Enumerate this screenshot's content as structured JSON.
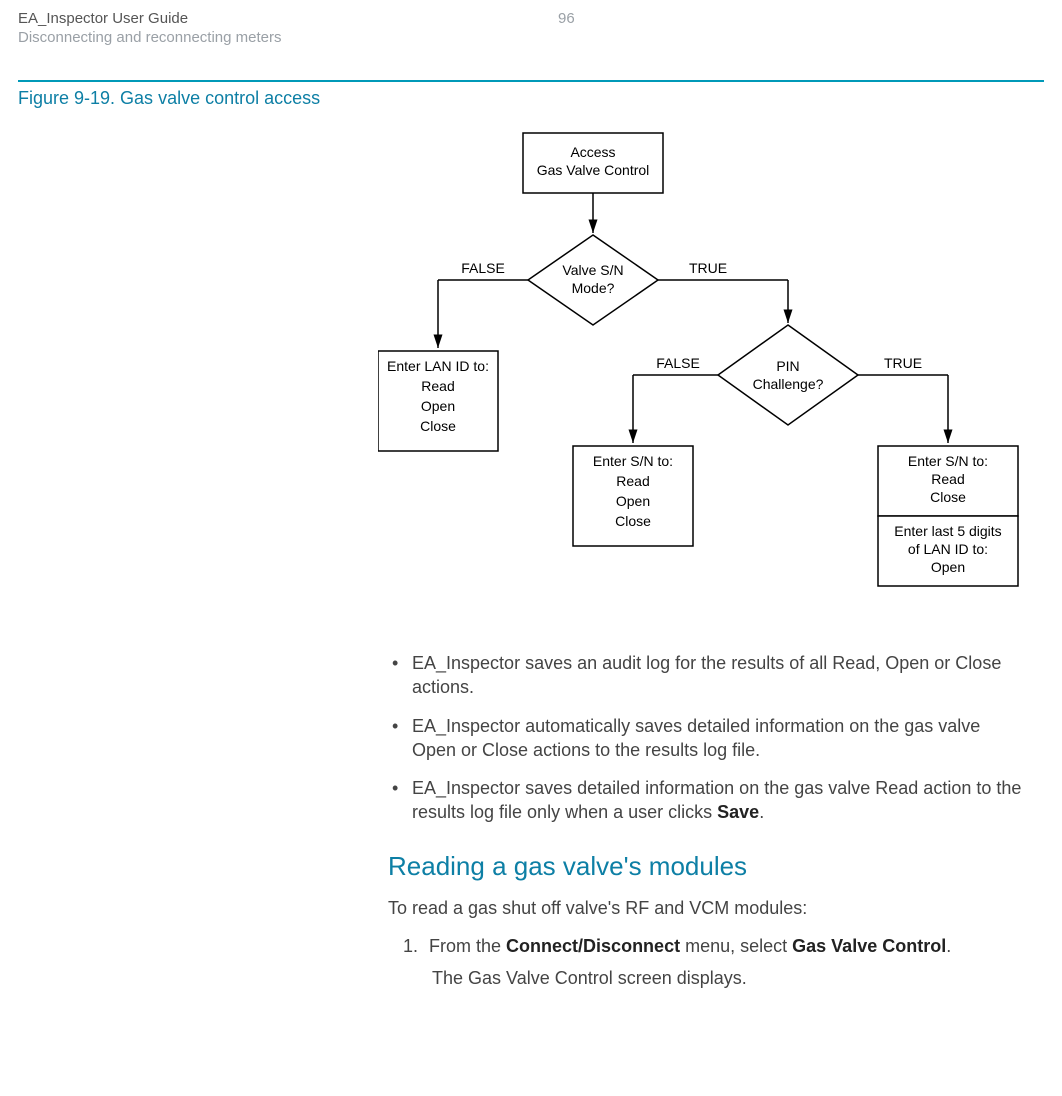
{
  "header": {
    "title": "EA_Inspector User Guide",
    "subtitle": "Disconnecting and reconnecting meters",
    "page_number": "96"
  },
  "figure": {
    "caption": "Figure 9-19. Gas valve control access",
    "nodes": {
      "access_l1": "Access",
      "access_l2": "Gas Valve Control",
      "decision1_l1": "Valve S/N",
      "decision1_l2": "Mode?",
      "decision2_l1": "PIN",
      "decision2_l2": "Challenge?",
      "lan_l1": "Enter LAN ID to:",
      "lan_l2": "Read",
      "lan_l3": "Open",
      "lan_l4": "Close",
      "sn_l1": "Enter S/N to:",
      "sn_l2": "Read",
      "sn_l3": "Open",
      "sn_l4": "Close",
      "sn_pin_top_l1": "Enter S/N to:",
      "sn_pin_top_l2": "Read",
      "sn_pin_top_l3": "Close",
      "sn_pin_bot_l1": "Enter last 5 digits",
      "sn_pin_bot_l2": "of LAN ID to:",
      "sn_pin_bot_l3": "Open"
    },
    "labels": {
      "false": "FALSE",
      "true": "TRUE"
    }
  },
  "bullets": [
    {
      "pre": "EA_Inspector saves an audit log for the results of all Read, Open or Close actions."
    },
    {
      "pre": "EA_Inspector automatically saves detailed information on the gas valve Open or Close actions to the results log file."
    },
    {
      "pre": "EA_Inspector saves detailed information on the gas valve Read action to the results log file only when a user clicks ",
      "bold": "Save",
      "post": "."
    }
  ],
  "section": {
    "heading": "Reading a gas valve's modules",
    "intro": "To read a gas shut off valve's RF and VCM modules:",
    "step1": {
      "num": "1.",
      "pre": "From the ",
      "bold1": "Connect/Disconnect",
      "mid": " menu, select ",
      "bold2": "Gas Valve Control",
      "post": ".",
      "follow": "The Gas Valve Control screen displays."
    }
  }
}
